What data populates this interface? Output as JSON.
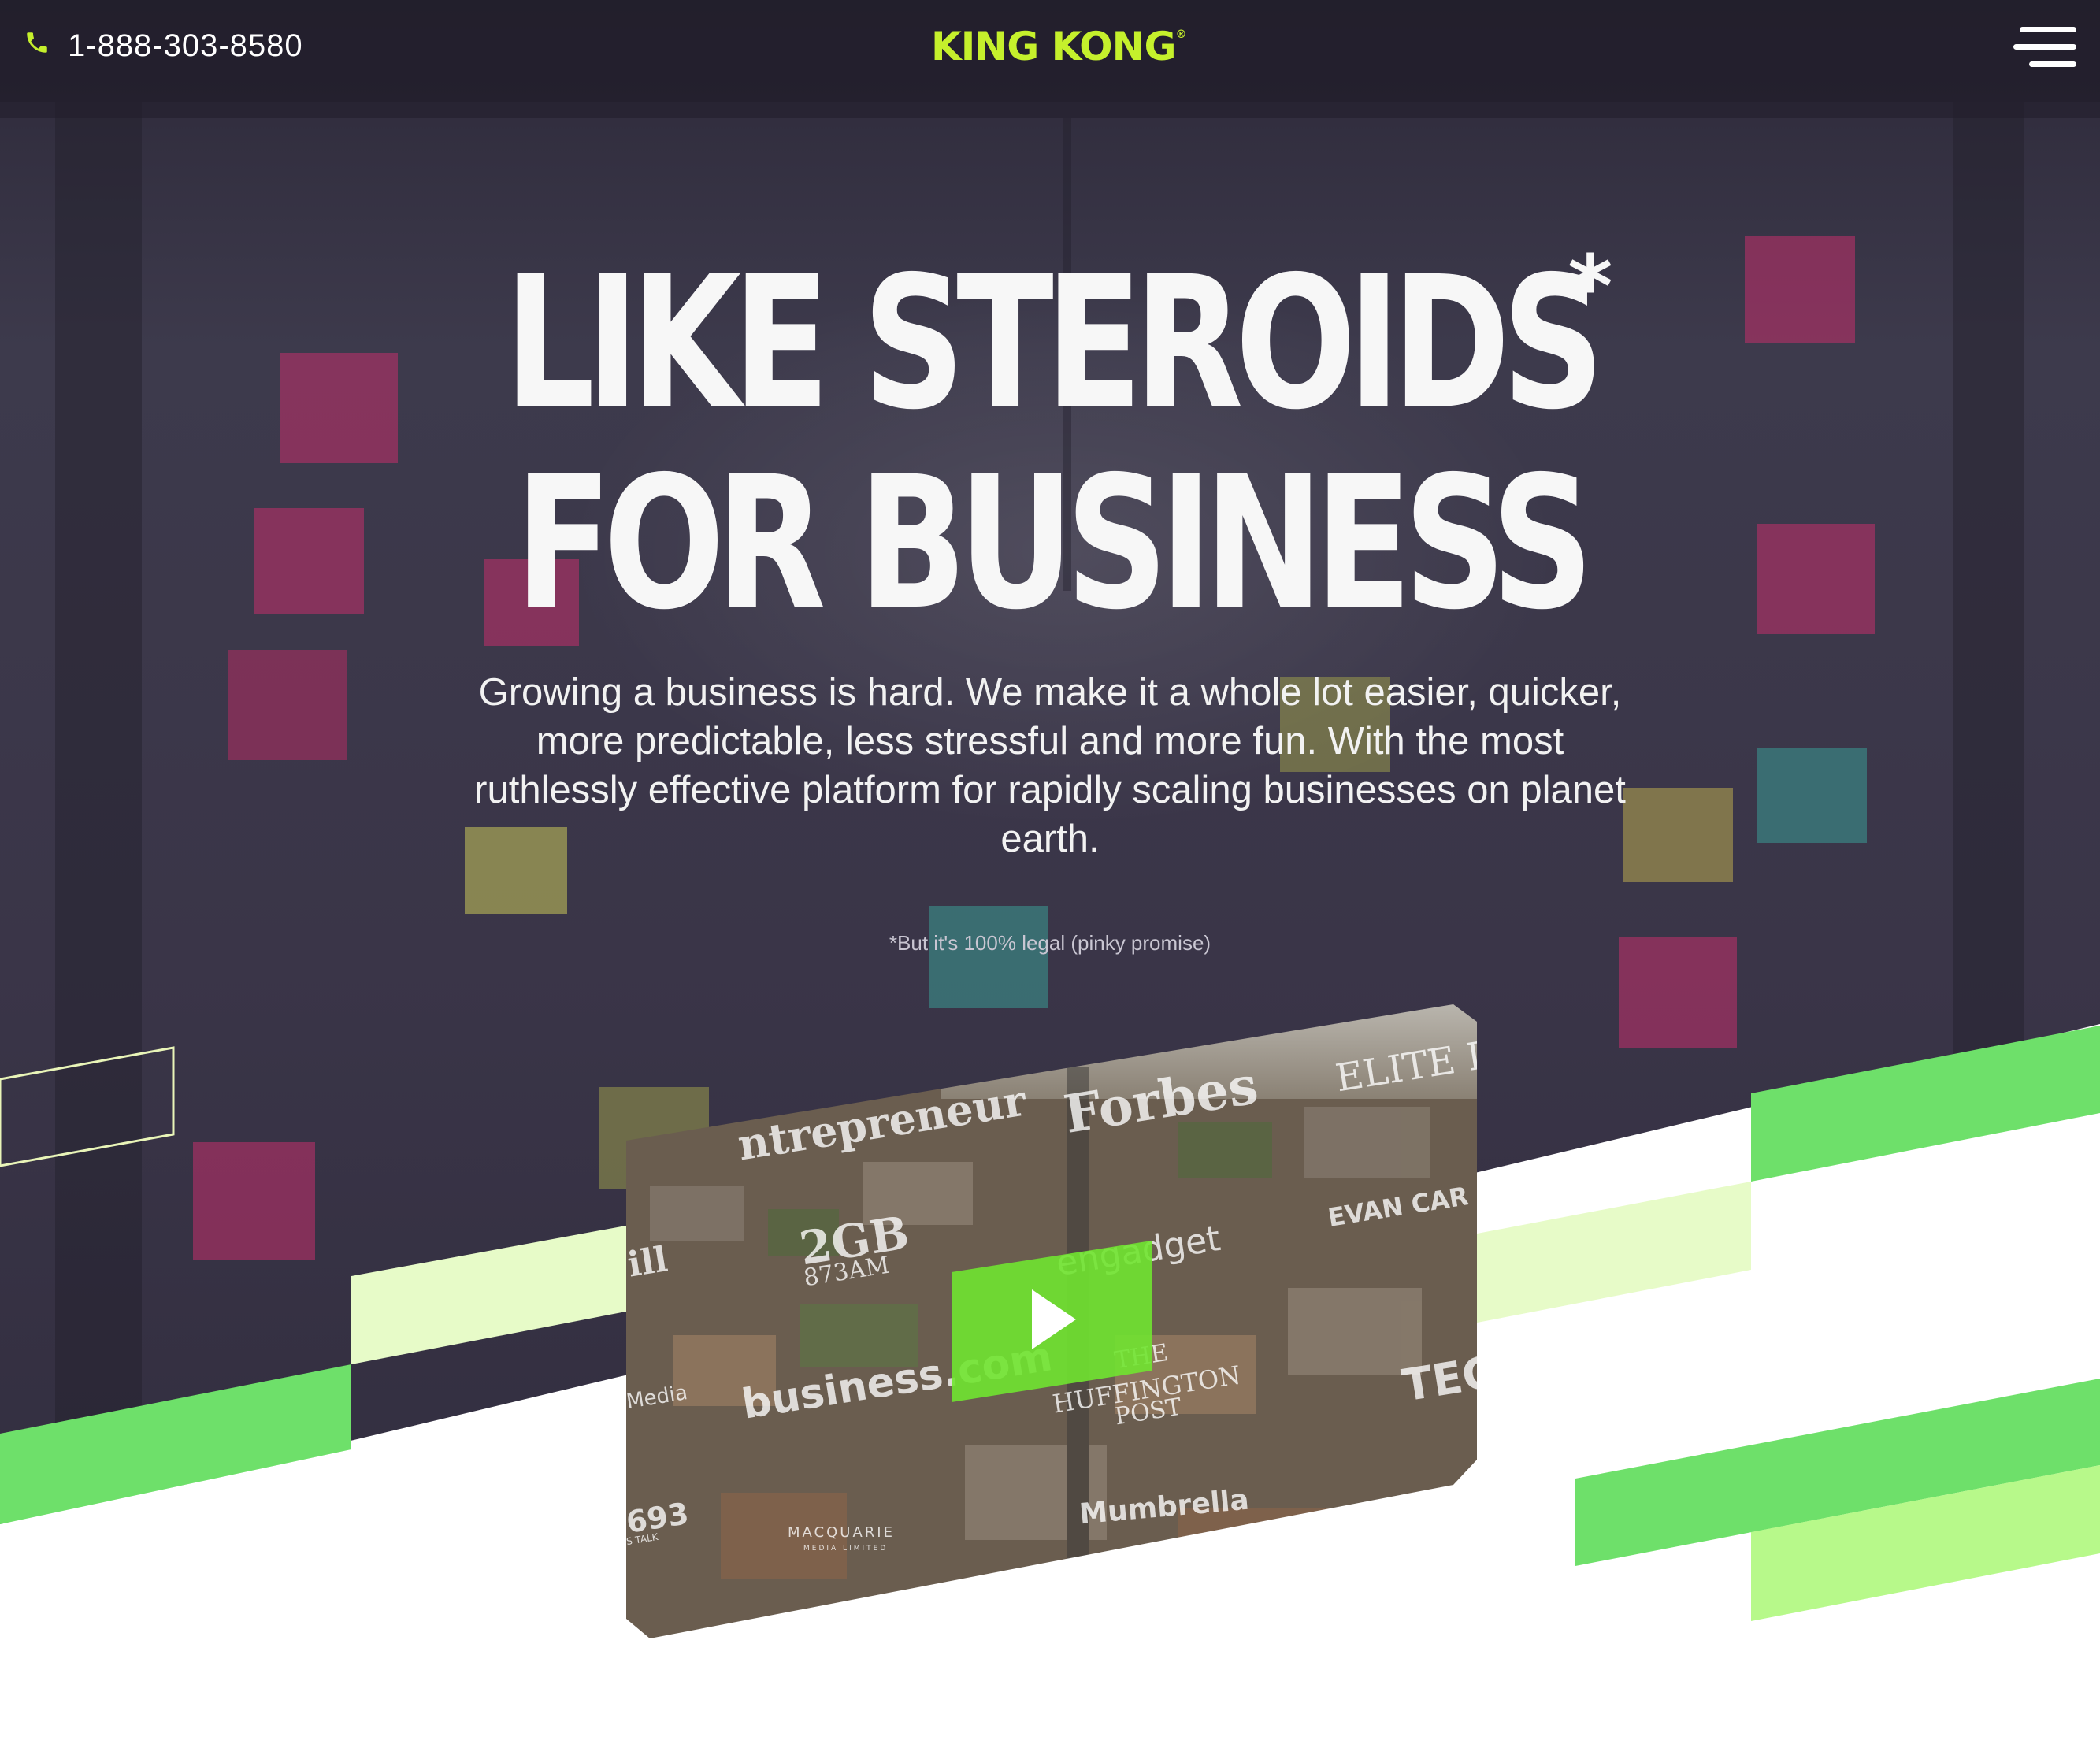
{
  "header": {
    "phone": "1-888-303-8580",
    "phone_icon": "phone-icon",
    "logo": "KING KONG",
    "logo_mark": "®",
    "menu_icon": "hamburger-menu-icon"
  },
  "hero": {
    "headline_line1": "LIKE STEROIDS",
    "headline_asterisk": "*",
    "headline_line2": "FOR BUSINESS",
    "subtitle": "Growing a business is hard. We make it a whole lot easier, quicker, more predictable, less stressful and more fun. With the most ruthlessly effective platform for rapidly scaling businesses on planet earth.",
    "legal_note": "*But it's 100% legal (pinky promise)"
  },
  "video": {
    "play_icon": "play-icon",
    "media_logos": [
      "ntrepreneur",
      "Forbes",
      "ELITE I",
      "ill",
      "2GB",
      "873AM",
      "engadget",
      "EVAN CAR",
      "Media",
      "business.com",
      "THE",
      "HUFFINGTON",
      "POST",
      "TECH",
      "693",
      "S TALK",
      "MACQUARIE",
      "MEDIA LIMITED",
      "Mumbrella"
    ]
  },
  "colors": {
    "accent": "#c5f02c",
    "green_dark": "#6ee06a",
    "green_light": "#e7fbc8",
    "green_mid": "#b7f98a",
    "hero_bg": "#3a3548",
    "play_button": "#70e430"
  }
}
